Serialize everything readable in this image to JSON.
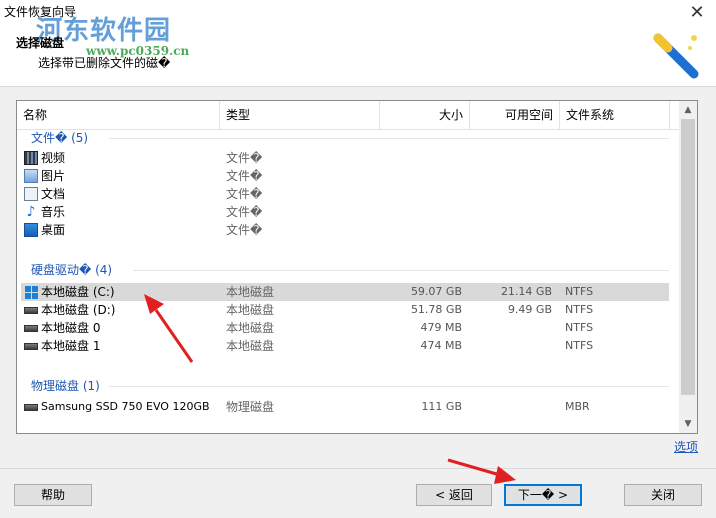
{
  "window": {
    "title": "文件恢复向导",
    "close_glyph": "✕"
  },
  "header": {
    "step_title": "选择磁盘",
    "step_desc": "选择带已删除文件的磁�",
    "watermark": "河东软件园",
    "watermark_sub": "www.pc0359.cn",
    "icon": "magic-wand-icon"
  },
  "columns": {
    "name": "名称",
    "type": "类型",
    "size": "大小",
    "free": "可用空间",
    "fs": "文件系统"
  },
  "groups": {
    "files": {
      "label": "文件� (5)",
      "items": [
        {
          "name": "视频",
          "type": "文件�",
          "icon": "video-icon"
        },
        {
          "name": "图片",
          "type": "文件�",
          "icon": "picture-icon"
        },
        {
          "name": "文档",
          "type": "文件�",
          "icon": "document-icon"
        },
        {
          "name": "音乐",
          "type": "文件�",
          "icon": "music-icon"
        },
        {
          "name": "桌面",
          "type": "文件�",
          "icon": "desktop-icon"
        }
      ]
    },
    "drives": {
      "label": "硬盘驱动� (4)",
      "items": [
        {
          "name": "本地磁盘 (C:)",
          "type": "本地磁盘",
          "size": "59.07 GB",
          "free": "21.14 GB",
          "fs": "NTFS",
          "icon": "windows-drive-icon",
          "selected": true
        },
        {
          "name": "本地磁盘 (D:)",
          "type": "本地磁盘",
          "size": "51.78 GB",
          "free": "9.49 GB",
          "fs": "NTFS",
          "icon": "drive-icon"
        },
        {
          "name": "本地磁盘 0",
          "type": "本地磁盘",
          "size": "479 MB",
          "free": "",
          "fs": "NTFS",
          "icon": "drive-icon"
        },
        {
          "name": "本地磁盘 1",
          "type": "本地磁盘",
          "size": "474 MB",
          "free": "",
          "fs": "NTFS",
          "icon": "drive-icon"
        }
      ]
    },
    "physical": {
      "label": "物理磁盘 (1)",
      "items": [
        {
          "name": "Samsung SSD 750 EVO 120GB",
          "type": "物理磁盘",
          "size": "111 GB",
          "free": "",
          "fs": "MBR",
          "icon": "drive-icon"
        }
      ]
    }
  },
  "options_link": "选项",
  "buttons": {
    "help": "帮助",
    "back": "< 返回",
    "next": "下一� >",
    "close": "关闭"
  },
  "colors": {
    "accent": "#0078d7",
    "link": "#1e56b4",
    "arrow": "#e02020"
  }
}
